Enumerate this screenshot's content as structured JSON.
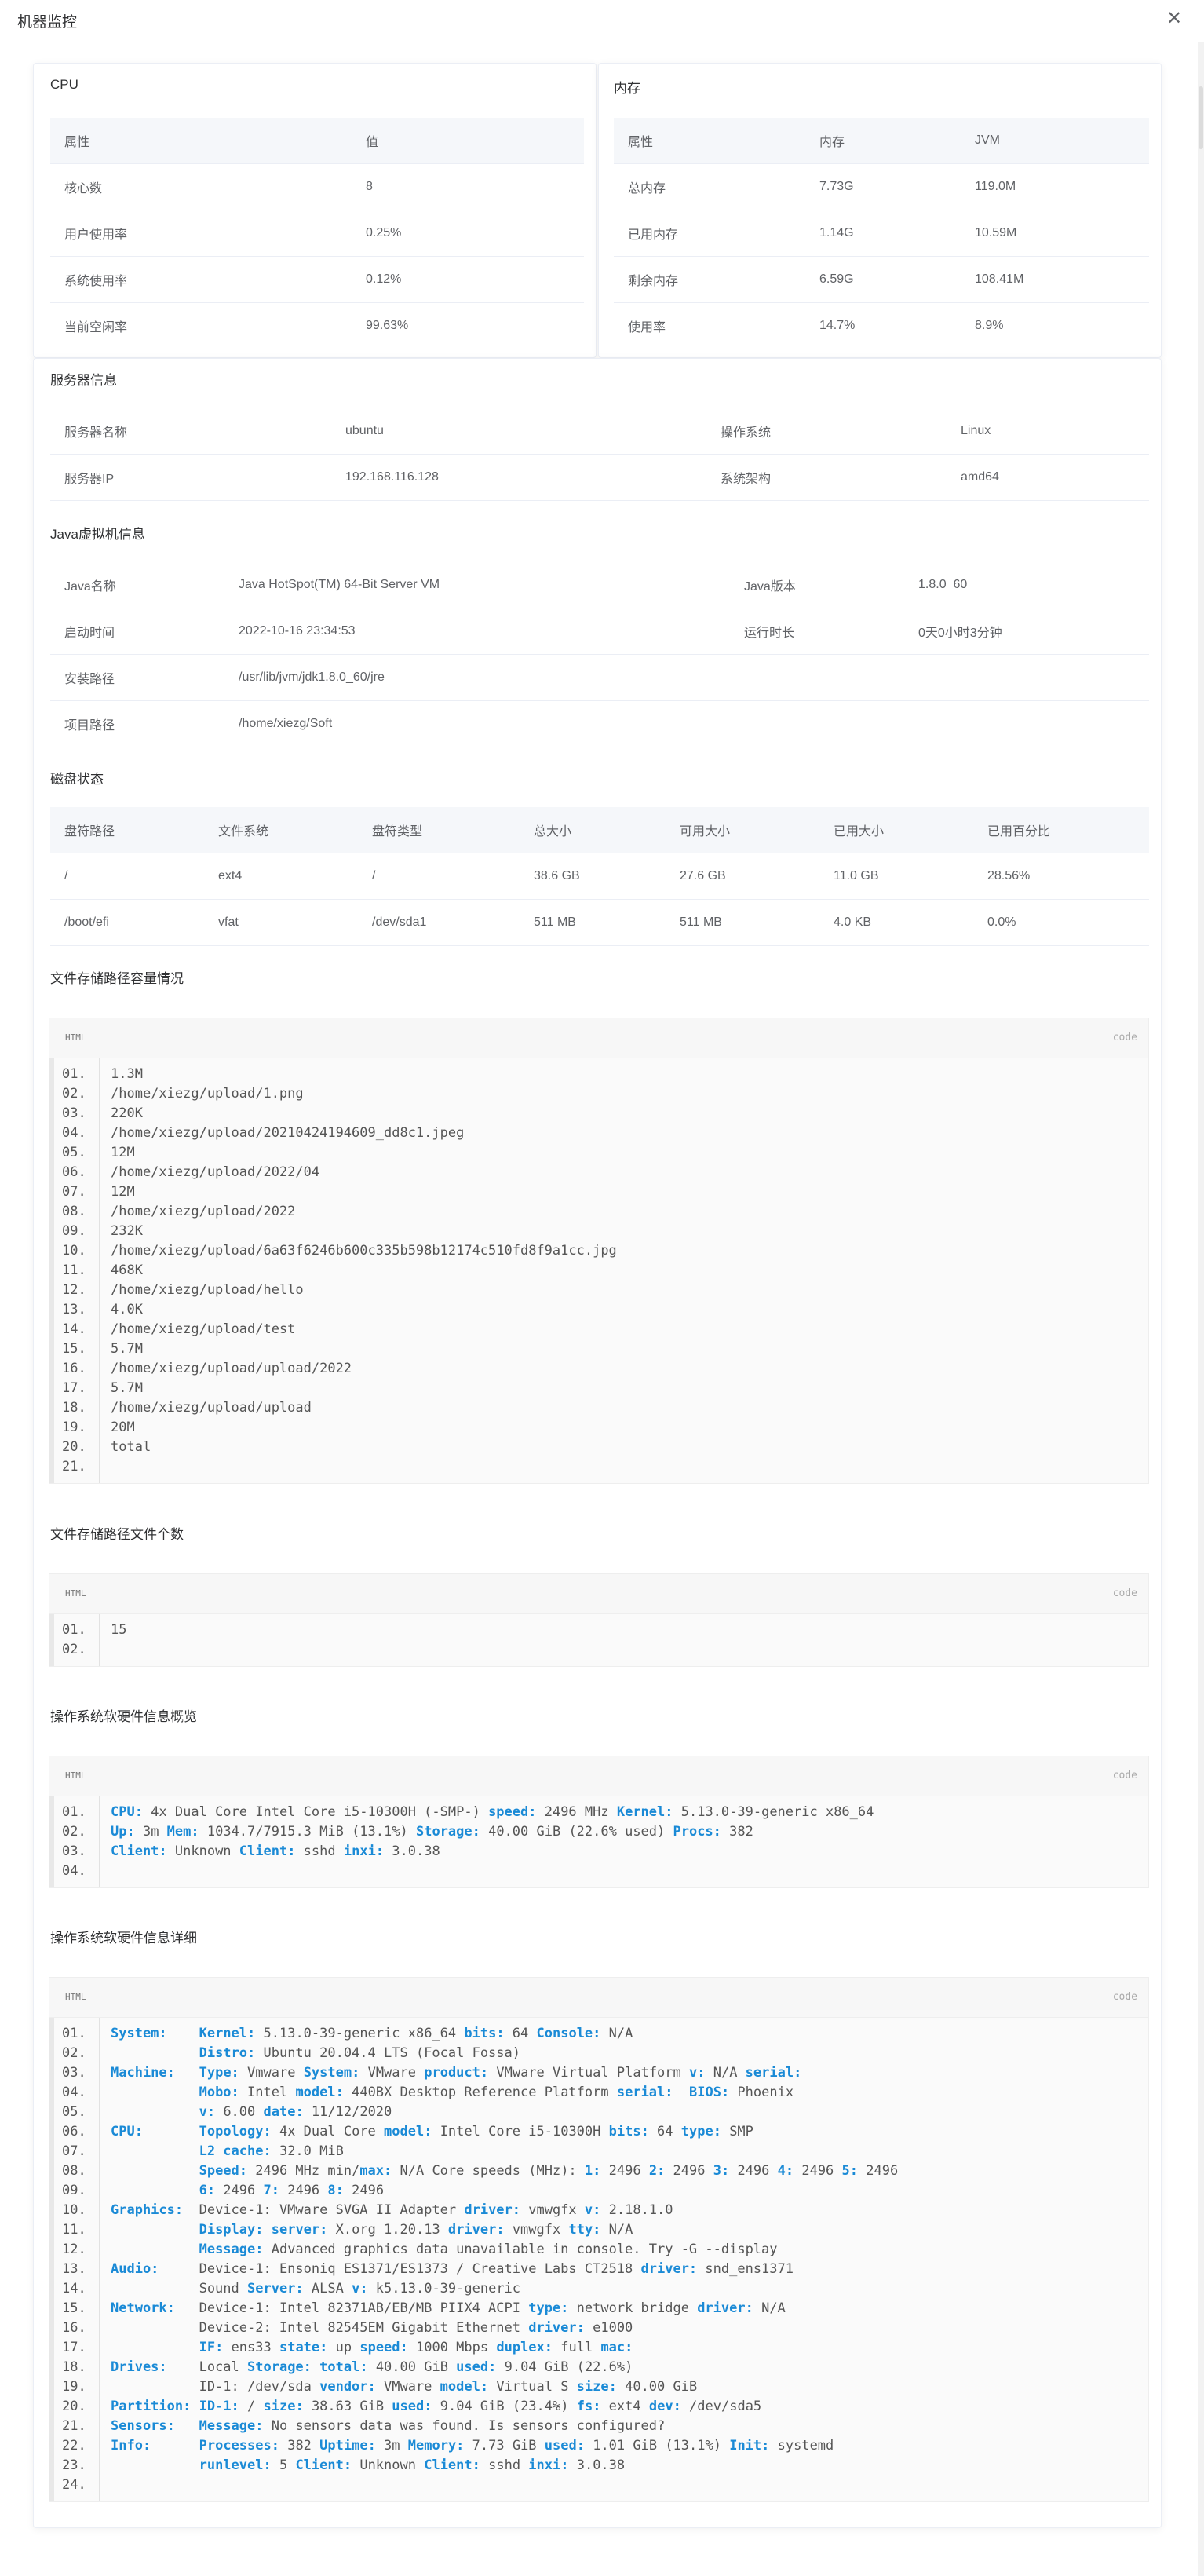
{
  "dialog": {
    "title": "机器监控",
    "close_icon": "close-icon"
  },
  "cpu": {
    "title": "CPU",
    "headers": [
      "属性",
      "值"
    ],
    "rows": [
      [
        "核心数",
        "8"
      ],
      [
        "用户使用率",
        "0.25%"
      ],
      [
        "系统使用率",
        "0.12%"
      ],
      [
        "当前空闲率",
        "99.63%"
      ]
    ]
  },
  "memory": {
    "title": "内存",
    "headers": [
      "属性",
      "内存",
      "JVM"
    ],
    "rows": [
      [
        "总内存",
        "7.73G",
        "119.0M"
      ],
      [
        "已用内存",
        "1.14G",
        "10.59M"
      ],
      [
        "剩余内存",
        "6.59G",
        "108.41M"
      ],
      [
        "使用率",
        "14.7%",
        "8.9%"
      ]
    ]
  },
  "server": {
    "title": "服务器信息",
    "rows": [
      [
        "服务器名称",
        "ubuntu",
        "操作系统",
        "Linux"
      ],
      [
        "服务器IP",
        "192.168.116.128",
        "系统架构",
        "amd64"
      ]
    ]
  },
  "jvm": {
    "title": "Java虚拟机信息",
    "rows": [
      [
        "Java名称",
        "Java HotSpot(TM) 64-Bit Server VM",
        "Java版本",
        "1.8.0_60"
      ],
      [
        "启动时间",
        "2022-10-16 23:34:53",
        "运行时长",
        "0天0小时3分钟"
      ]
    ],
    "install_label": "安装路径",
    "install_value": "/usr/lib/jvm/jdk1.8.0_60/jre",
    "project_label": "项目路径",
    "project_value": "/home/xiezg/Soft"
  },
  "disk": {
    "title": "磁盘状态",
    "headers": [
      "盘符路径",
      "文件系统",
      "盘符类型",
      "总大小",
      "可用大小",
      "已用大小",
      "已用百分比"
    ],
    "rows": [
      [
        "/",
        "ext4",
        "/",
        "38.6 GB",
        "27.6 GB",
        "11.0 GB",
        "28.56%"
      ],
      [
        "/boot/efi",
        "vfat",
        "/dev/sda1",
        "511 MB",
        "511 MB",
        "4.0 KB",
        "0.0%"
      ]
    ]
  },
  "code_lang": "HTML",
  "code_tag": "code",
  "storage_capacity": {
    "title": "文件存储路径容量情况",
    "lines": [
      "1.3M",
      "/home/xiezg/upload/1.png",
      "220K",
      "/home/xiezg/upload/20210424194609_dd8c1.jpeg",
      "12M",
      "/home/xiezg/upload/2022/04",
      "12M",
      "/home/xiezg/upload/2022",
      "232K",
      "/home/xiezg/upload/6a63f6246b600c335b598b12174c510fd8f9a1cc.jpg",
      "468K",
      "/home/xiezg/upload/hello",
      "4.0K",
      "/home/xiezg/upload/test",
      "5.7M",
      "/home/xiezg/upload/upload/2022",
      "5.7M",
      "/home/xiezg/upload/upload",
      "20M",
      "total",
      ""
    ]
  },
  "storage_count": {
    "title": "文件存储路径文件个数",
    "lines": [
      "15",
      ""
    ]
  },
  "os_summary": {
    "title": "操作系统软硬件信息概览",
    "lines": [
      "[[CPU:]] 4x Dual Core Intel Core i5-10300H (-SMP-) [[speed:]] 2496 MHz [[Kernel:]] 5.13.0-39-generic x86_64",
      "[[Up:]] 3m [[Mem:]] 1034.7/7915.3 MiB (13.1%) [[Storage:]] 40.00 GiB (22.6% used) [[Procs:]] 382",
      "[[Client:]] Unknown [[Client:]] sshd [[inxi:]] 3.0.38",
      ""
    ]
  },
  "os_detail": {
    "title": "操作系统软硬件信息详细",
    "lines": [
      "[[System:]]    [[Kernel:]] 5.13.0-39-generic x86_64 [[bits:]] 64 [[Console:]] N/A",
      "           [[Distro:]] Ubuntu 20.04.4 LTS (Focal Fossa)",
      "[[Machine:]]   [[Type:]] Vmware [[System:]] VMware [[product:]] VMware Virtual Platform [[v:]] N/A [[serial:]]",
      "           [[Mobo:]] Intel [[model:]] 440BX Desktop Reference Platform [[serial:]]  [[BIOS:]] Phoenix",
      "           [[v:]] 6.00 [[date:]] 11/12/2020",
      "[[CPU:]]       [[Topology:]] 4x Dual Core [[model:]] Intel Core i5-10300H [[bits:]] 64 [[type:]] SMP",
      "           [[L2 cache:]] 32.0 MiB",
      "           [[Speed:]] 2496 MHz min/[[max:]] N/A Core speeds (MHz): [[1:]] 2496 [[2:]] 2496 [[3:]] 2496 [[4:]] 2496 [[5:]] 2496",
      "           [[6:]] 2496 [[7:]] 2496 [[8:]] 2496",
      "[[Graphics:]]  Device-1: VMware SVGA II Adapter [[driver:]] vmwgfx [[v:]] 2.18.1.0",
      "           [[Display:]] [[server:]] X.org 1.20.13 [[driver:]] vmwgfx [[tty:]] N/A",
      "           [[Message:]] Advanced graphics data unavailable in console. Try -G --display",
      "[[Audio:]]     Device-1: Ensoniq ES1371/ES1373 / Creative Labs CT2518 [[driver:]] snd_ens1371",
      "           Sound [[Server:]] ALSA [[v:]] k5.13.0-39-generic",
      "[[Network:]]   Device-1: Intel 82371AB/EB/MB PIIX4 ACPI [[type:]] network bridge [[driver:]] N/A",
      "           Device-2: Intel 82545EM Gigabit Ethernet [[driver:]] e1000",
      "           [[IF:]] ens33 [[state:]] up [[speed:]] 1000 Mbps [[duplex:]] full [[mac:]]",
      "[[Drives:]]    Local [[Storage:]] [[total:]] 40.00 GiB [[used:]] 9.04 GiB (22.6%)",
      "           ID-1: /dev/sda [[vendor:]] VMware [[model:]] Virtual S [[size:]] 40.00 GiB",
      "[[Partition:]] [[ID-1:]] / [[size:]] 38.63 GiB [[used:]] 9.04 GiB (23.4%) [[fs:]] ext4 [[dev:]] /dev/sda5",
      "[[Sensors:]]   [[Message:]] No sensors data was found. Is sensors configured?",
      "[[Info:]]      [[Processes:]] 382 [[Uptime:]] 3m [[Memory:]] 7.73 GiB [[used:]] 1.01 GiB (13.1%) [[Init:]] systemd",
      "           [[runlevel:]] 5 [[Client:]] Unknown [[Client:]] sshd [[inxi:]] 3.0.38",
      ""
    ]
  }
}
